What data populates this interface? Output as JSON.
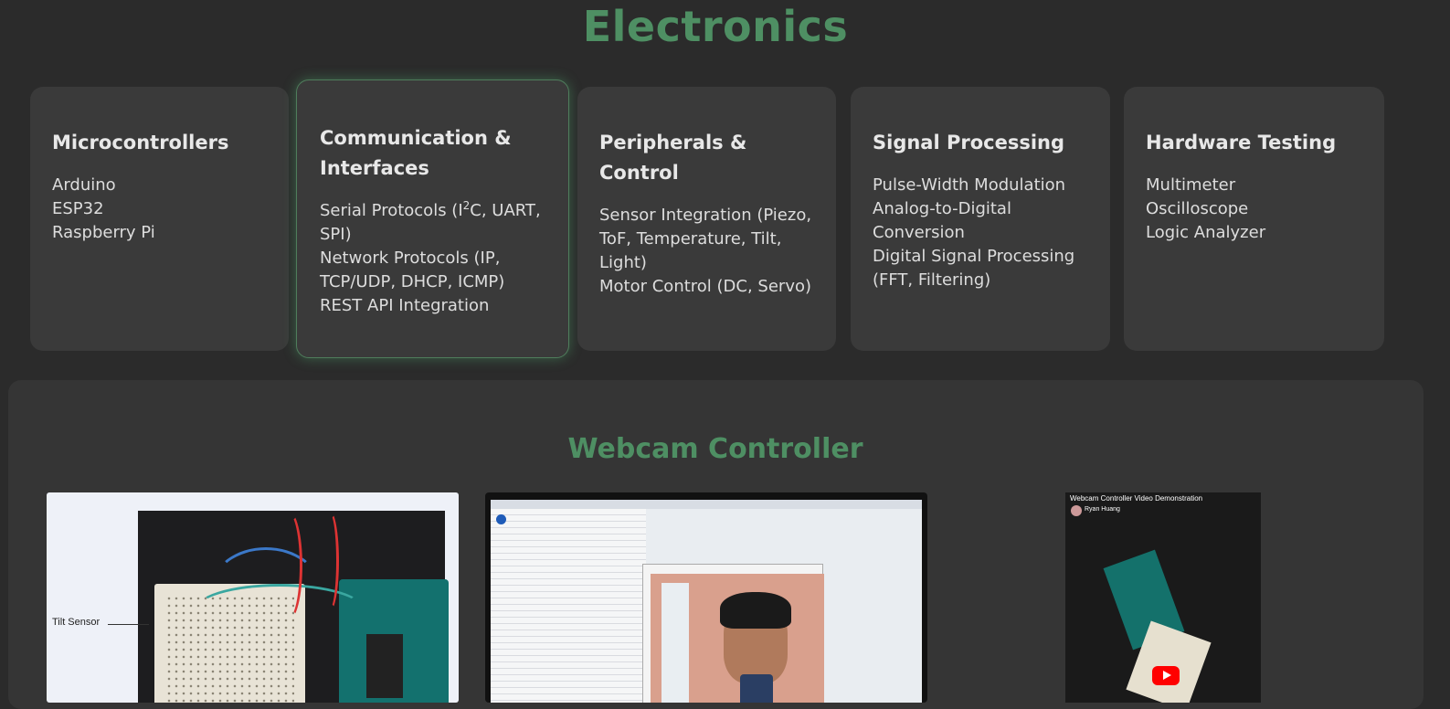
{
  "section": {
    "title": "Electronics"
  },
  "cards": [
    {
      "title": "Microcontrollers",
      "items": [
        "Arduino",
        "ESP32",
        "Raspberry Pi"
      ]
    },
    {
      "title": "Communication & Interfaces",
      "items": [
        "Serial Protocols (I",
        "2",
        "C, UART, SPI)",
        "Network Protocols (IP, TCP/UDP, DHCP, ICMP)",
        "REST API Integration"
      ]
    },
    {
      "title": "Peripherals & Control",
      "items": [
        "Sensor Integration (Piezo, ToF, Temperature, Tilt, Light)",
        "Motor Control (DC, Servo)"
      ]
    },
    {
      "title": "Signal Processing",
      "items": [
        "Pulse-Width Modulation",
        "Analog-to-Digital Conversion",
        "Digital Signal Processing (FFT, Filtering)"
      ]
    },
    {
      "title": "Hardware Testing",
      "items": [
        "Multimeter",
        "Oscilloscope",
        "Logic Analyzer"
      ]
    }
  ],
  "project": {
    "title": "Webcam Controller",
    "photo_label": "Tilt Sensor",
    "video_title": "Webcam Controller Video Demonstration",
    "video_author": "Ryan Huang"
  },
  "colors": {
    "accent": "#4e8f63",
    "background": "#2b2b2b",
    "card": "#3a3a3a"
  }
}
